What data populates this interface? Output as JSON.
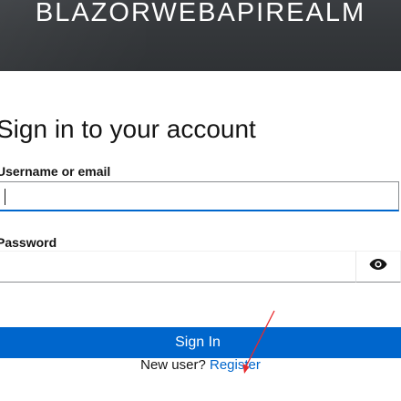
{
  "header": {
    "realm_name": "BLAZORWEBAPIREALM"
  },
  "form": {
    "title": "Sign in to your account",
    "username_label": "Username or email",
    "username_value": "",
    "password_label": "Password",
    "password_value": "",
    "show_password_icon": "eye-icon",
    "submit_label": "Sign In"
  },
  "register": {
    "prompt": "New user?",
    "link_label": "Register"
  },
  "colors": {
    "header_bg": "#34373a",
    "primary": "#0066cc",
    "annotation_arrow": "#e8292c"
  }
}
